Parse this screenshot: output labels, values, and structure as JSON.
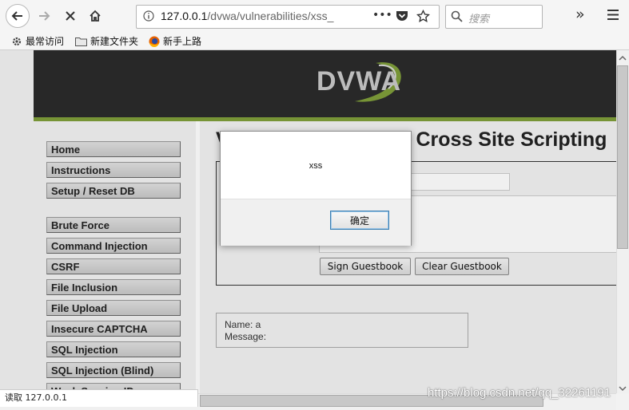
{
  "browser": {
    "url_host": "127.0.0.1",
    "url_path": "/dvwa/vulnerabilities/xss_",
    "search_placeholder": "搜索",
    "page_actions_label": "•••",
    "overflow_label": "»",
    "bookmarks": [
      {
        "label": "最常访问",
        "icon": "gear-icon"
      },
      {
        "label": "新建文件夹",
        "icon": "folder-icon"
      },
      {
        "label": "新手上路",
        "icon": "firefox-icon"
      }
    ],
    "status_text": "读取 127.0.0.1"
  },
  "dvwa": {
    "logo": "DVWA",
    "logo_color": "#c8c8c8",
    "accent_color": "#7f9e3a",
    "page_title": "Vulnerability: Stored Cross Site Scripting",
    "menu_group1": [
      "Home",
      "Instructions",
      "Setup / Reset DB"
    ],
    "menu_group2": [
      "Brute Force",
      "Command Injection",
      "CSRF",
      "File Inclusion",
      "File Upload",
      "Insecure CAPTCHA",
      "SQL Injection",
      "SQL Injection (Blind)",
      "Weak Session IDs"
    ],
    "sign_button": "Sign Guestbook",
    "clear_button": "Clear Guestbook",
    "entry_name": "Name: a",
    "entry_message": "Message:"
  },
  "alert": {
    "message": "xss",
    "ok_label": "确定"
  },
  "watermark": "https://blog.csdn.net/qq_32261191"
}
